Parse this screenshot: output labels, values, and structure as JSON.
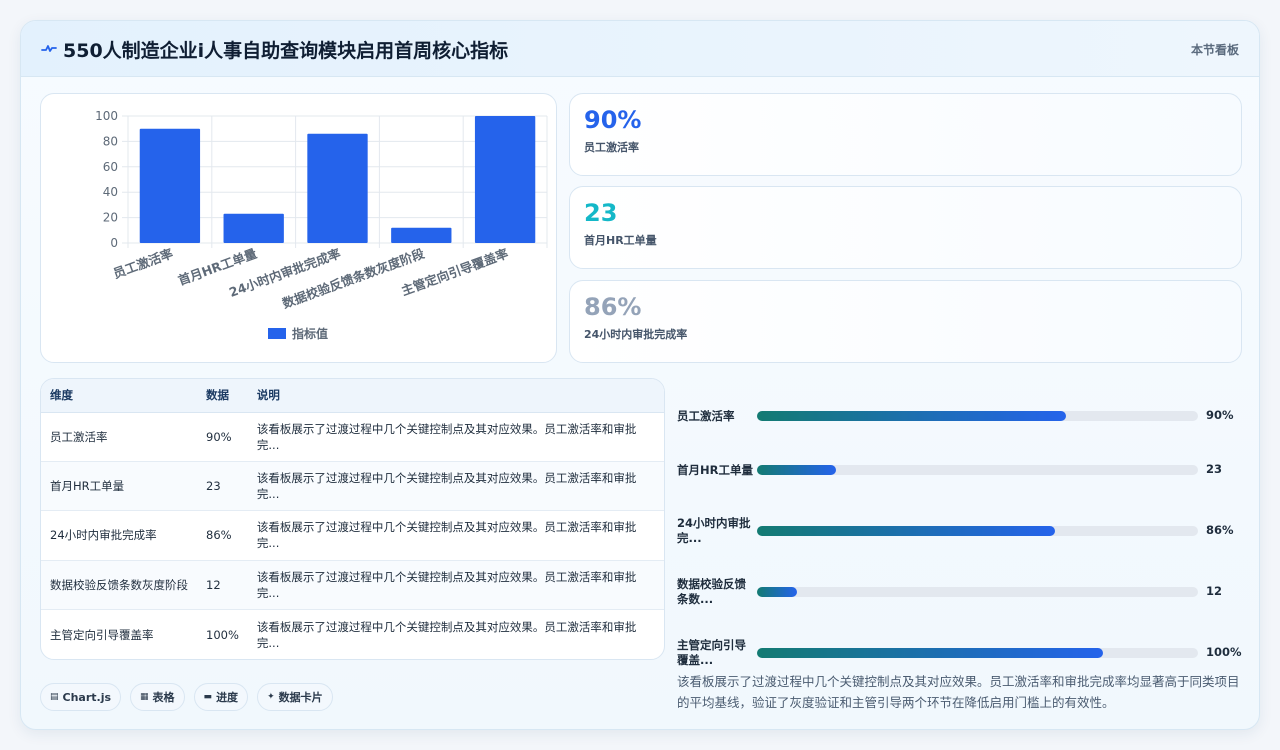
{
  "header": {
    "title": "550人制造企业i人事自助查询模块启用首周核心指标",
    "badge": "本节看板",
    "icon": "pulse-icon"
  },
  "chart_data": {
    "type": "bar",
    "categories": [
      "员工激活率",
      "首月HR工单量",
      "24小时内审批完成率",
      "数据校验反馈条数灰度阶段",
      "主管定向引导覆盖率"
    ],
    "series": [
      {
        "name": "指标值",
        "values": [
          90,
          23,
          86,
          12,
          100
        ],
        "color": "#2563eb"
      }
    ],
    "ylim": [
      0,
      100
    ],
    "yticks": [
      0,
      20,
      40,
      60,
      80,
      100
    ],
    "grid": true,
    "legend": "bottom"
  },
  "kpis": [
    {
      "value": "90%",
      "label": "员工激活率",
      "color": "#2563eb"
    },
    {
      "value": "23",
      "label": "首月HR工单量",
      "color": "#14b8c8"
    },
    {
      "value": "86%",
      "label": "24小时内审批完成率",
      "color": "#94a3b8"
    }
  ],
  "table": {
    "headers": [
      "维度",
      "数据",
      "说明"
    ],
    "rows": [
      {
        "dim": "员工激活率",
        "data": "90%",
        "desc": "该看板展示了过渡过程中几个关键控制点及其对应效果。员工激活率和审批完..."
      },
      {
        "dim": "首月HR工单量",
        "data": "23",
        "desc": "该看板展示了过渡过程中几个关键控制点及其对应效果。员工激活率和审批完..."
      },
      {
        "dim": "24小时内审批完成率",
        "data": "86%",
        "desc": "该看板展示了过渡过程中几个关键控制点及其对应效果。员工激活率和审批完..."
      },
      {
        "dim": "数据校验反馈条数灰度阶段",
        "data": "12",
        "desc": "该看板展示了过渡过程中几个关键控制点及其对应效果。员工激活率和审批完..."
      },
      {
        "dim": "主管定向引导覆盖率",
        "data": "100%",
        "desc": "该看板展示了过渡过程中几个关键控制点及其对应效果。员工激活率和审批完..."
      }
    ]
  },
  "progress": [
    {
      "label": "员工激活率",
      "value": "90%",
      "level": 0.7
    },
    {
      "label": "首月HR工单量",
      "value": "23",
      "level": 0.18
    },
    {
      "label": "24小时内审批完...",
      "value": "86%",
      "level": 0.675
    },
    {
      "label": "数据校验反馈条数...",
      "value": "12",
      "level": 0.09
    },
    {
      "label": "主管定向引导覆盖...",
      "value": "100%",
      "level": 0.785
    }
  ],
  "summary": "该看板展示了过渡过程中几个关键控制点及其对应效果。员工激活率和审批完成率均显著高于同类项目的平均基线，验证了灰度验证和主管引导两个环节在降低启用门槛上的有效性。",
  "chips": [
    {
      "icon": "chart-icon",
      "glyph": "▤",
      "label": "Chart.js"
    },
    {
      "icon": "table-icon",
      "glyph": "▦",
      "label": "表格"
    },
    {
      "icon": "progress-icon",
      "glyph": "▬",
      "label": "进度"
    },
    {
      "icon": "sparkle-icon",
      "glyph": "✦",
      "label": "数据卡片"
    }
  ]
}
